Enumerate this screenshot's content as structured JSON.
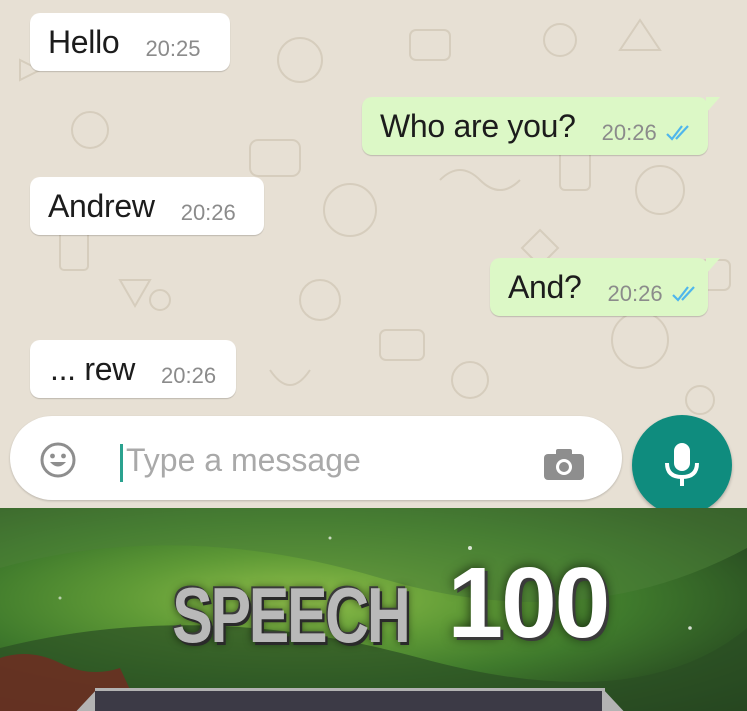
{
  "conversation": {
    "messages": [
      {
        "direction": "incoming",
        "text": "Hello",
        "time": "20:25"
      },
      {
        "direction": "outgoing",
        "text": "Who are you?",
        "time": "20:26",
        "status": "read-double-tick"
      },
      {
        "direction": "incoming",
        "text": "Andrew",
        "time": "20:26"
      },
      {
        "direction": "outgoing",
        "text": "And?",
        "time": "20:26",
        "status": "read-double-tick"
      },
      {
        "direction": "incoming",
        "text": "... rew",
        "time": "20:26"
      }
    ]
  },
  "composer": {
    "placeholder": "Type a message",
    "value": "",
    "emoji_icon": "emoji-icon",
    "camera_icon": "camera-icon",
    "mic_icon": "microphone-icon"
  },
  "banner": {
    "skill": "SPEECH",
    "level": "100"
  },
  "colors": {
    "incoming_bubble": "#ffffff",
    "outgoing_bubble": "#dcf8c6",
    "read_tick": "#4fb6ec",
    "accent": "#0f8c7e",
    "chat_background": "#e7e0d4"
  }
}
